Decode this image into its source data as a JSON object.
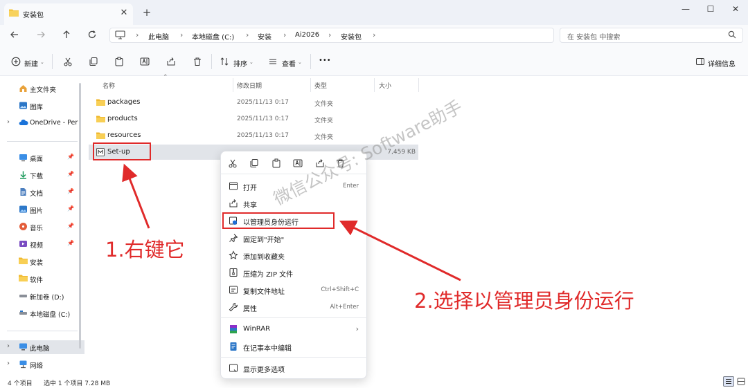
{
  "window": {
    "tab_title": "安装包",
    "new_tab": "+",
    "close_tab": "✕",
    "minimize": "—",
    "maximize": "☐",
    "close": "✕"
  },
  "address": {
    "crumbs": [
      "此电脑",
      "本地磁盘 (C:)",
      "安装",
      "Ai2026",
      "安装包"
    ],
    "search_placeholder": "在 安装包 中搜索"
  },
  "toolbar": {
    "new_label": "新建",
    "sort_label": "排序",
    "view_label": "查看",
    "more_label": "•••",
    "details_label": "详细信息"
  },
  "sidebar": {
    "items": [
      {
        "label": "主文件夹",
        "icon": "home-icon"
      },
      {
        "label": "图库",
        "icon": "gallery-icon"
      },
      {
        "label": "OneDrive - Per",
        "icon": "onedrive-icon"
      },
      {
        "label": "桌面",
        "icon": "desktop-icon"
      },
      {
        "label": "下载",
        "icon": "download-icon"
      },
      {
        "label": "文档",
        "icon": "documents-icon"
      },
      {
        "label": "图片",
        "icon": "pictures-icon"
      },
      {
        "label": "音乐",
        "icon": "music-icon"
      },
      {
        "label": "视频",
        "icon": "videos-icon"
      },
      {
        "label": "安装",
        "icon": "folder-icon"
      },
      {
        "label": "软件",
        "icon": "folder-icon"
      },
      {
        "label": "新加卷 (D:)",
        "icon": "drive-icon"
      },
      {
        "label": "本地磁盘 (C:)",
        "icon": "drive-icon"
      },
      {
        "label": "此电脑",
        "icon": "computer-icon"
      },
      {
        "label": "网络",
        "icon": "network-icon"
      }
    ]
  },
  "columns": {
    "name": "名称",
    "date": "修改日期",
    "type": "类型",
    "size": "大小"
  },
  "files": [
    {
      "name": "packages",
      "date": "2025/11/13 0:17",
      "type": "文件夹",
      "size": ""
    },
    {
      "name": "products",
      "date": "2025/11/13 0:17",
      "type": "文件夹",
      "size": ""
    },
    {
      "name": "resources",
      "date": "2025/11/13 0:17",
      "type": "文件夹",
      "size": ""
    },
    {
      "name": "Set-up",
      "date": "",
      "type": "",
      "size": "7,459 KB"
    }
  ],
  "status": {
    "count": "4 个项目",
    "selected": "选中 1 个项目  7.28 MB"
  },
  "context_menu": {
    "items": [
      {
        "label": "打开",
        "shortcut": "Enter"
      },
      {
        "label": "共享",
        "shortcut": ""
      },
      {
        "label": "以管理员身份运行",
        "shortcut": ""
      },
      {
        "label": "固定到\"开始\"",
        "shortcut": ""
      },
      {
        "label": "添加到收藏夹",
        "shortcut": ""
      },
      {
        "label": "压缩为 ZIP 文件",
        "shortcut": ""
      },
      {
        "label": "复制文件地址",
        "shortcut": "Ctrl+Shift+C"
      },
      {
        "label": "属性",
        "shortcut": "Alt+Enter"
      },
      {
        "label": "WinRAR",
        "shortcut": ""
      },
      {
        "label": "在记事本中编辑",
        "shortcut": ""
      },
      {
        "label": "显示更多选项",
        "shortcut": ""
      }
    ]
  },
  "annotations": {
    "step1": "1.右键它",
    "step2": "2.选择以管理员身份运行",
    "watermark": "微信公众号: Software助手"
  },
  "colors": {
    "accent": "#0067c0",
    "annotation": "#e02a2a",
    "folder": "#f4c542"
  }
}
